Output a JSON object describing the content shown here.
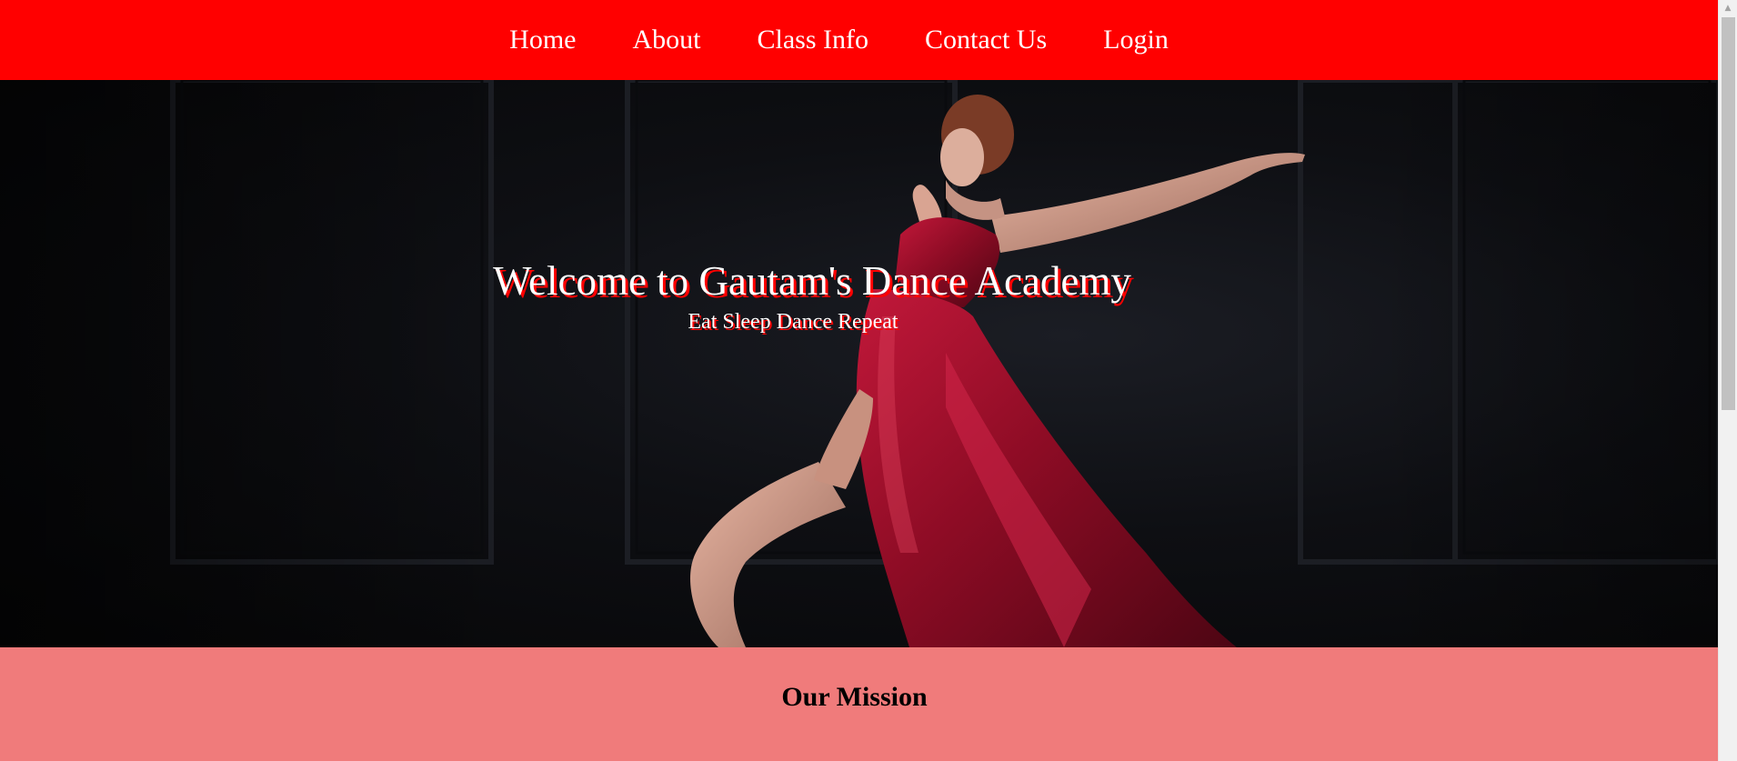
{
  "nav": {
    "items": [
      {
        "label": "Home"
      },
      {
        "label": "About"
      },
      {
        "label": "Class Info"
      },
      {
        "label": "Contact Us"
      },
      {
        "label": "Login"
      }
    ],
    "background_color": "#ff0000"
  },
  "hero": {
    "title": "Welcome to Gautam's Dance Academy",
    "subtitle": "Eat Sleep Dance Repeat",
    "text_shadow_color": "#ff0000",
    "image_subject": "dancer-in-red-dress"
  },
  "mission": {
    "heading": "Our Mission",
    "background_color": "#f07b7b"
  },
  "scrollbar": {
    "arrow_icon": "scroll-up-arrow-icon"
  }
}
